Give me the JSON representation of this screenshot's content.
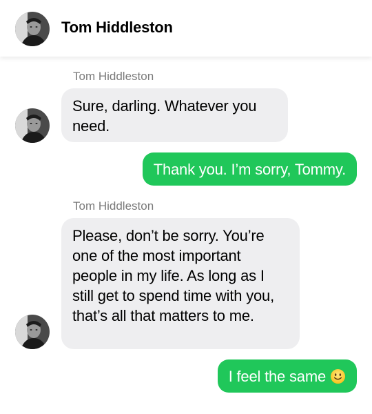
{
  "header": {
    "contact_name": "Tom Hiddleston"
  },
  "messages": [
    {
      "direction": "incoming",
      "sender": "Tom Hiddleston",
      "text": "Sure, darling. Whatever you need."
    },
    {
      "direction": "outgoing",
      "text": "Thank you. I’m sorry, Tommy."
    },
    {
      "direction": "incoming",
      "sender": "Tom Hiddleston",
      "text": "Please, don’t be sorry. You’re one of the most important people in my life. As long as I still get to spend time with you, that’s all that matters to me."
    },
    {
      "direction": "outgoing",
      "text": "I feel the same",
      "emoji": "slightly-smiling-face"
    }
  ],
  "colors": {
    "outgoing_bubble": "#20c75a",
    "incoming_bubble": "#eeeef0",
    "sender_label": "#7a7a7a"
  }
}
